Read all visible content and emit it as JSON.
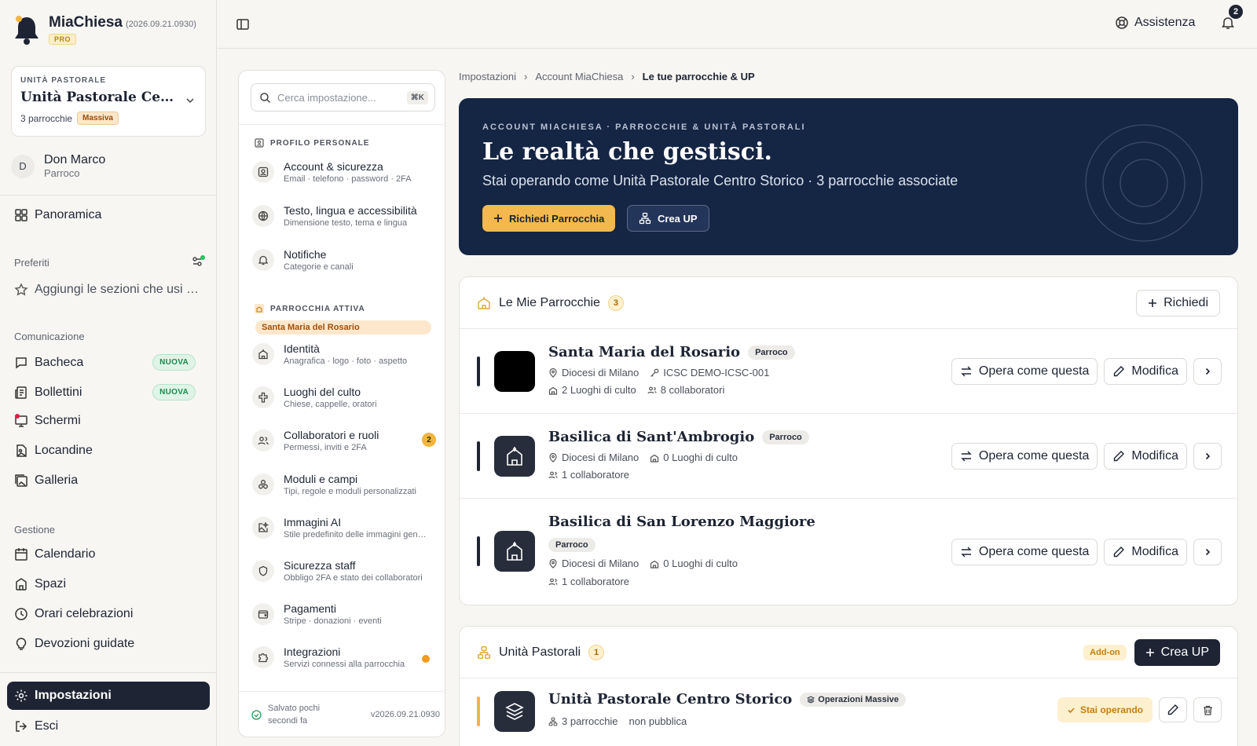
{
  "app": {
    "name": "MiaChiesa",
    "version": "(2026.09.21.0930)",
    "tier": "PRO"
  },
  "unit_card": {
    "eyebrow": "UNITÀ PASTORALE",
    "name": "Unità Pastorale Centro Storico",
    "parishes": "3 parrocchie",
    "badge": "Massiva"
  },
  "user": {
    "initial": "D",
    "name": "Don Marco",
    "role": "Parroco"
  },
  "nav": {
    "overview": "Panoramica",
    "favorites_title": "Preferiti",
    "favorites_hint": "Aggiungi le sezioni che usi …",
    "comm_title": "Comunicazione",
    "comm": [
      {
        "label": "Bacheca",
        "badge": "NUOVA"
      },
      {
        "label": "Bollettini",
        "badge": "NUOVA"
      },
      {
        "label": "Schermi"
      },
      {
        "label": "Locandine"
      },
      {
        "label": "Galleria"
      }
    ],
    "mgmt_title": "Gestione",
    "mgmt": [
      "Calendario",
      "Spazi",
      "Orari celebrazioni",
      "Devozioni guidate"
    ],
    "settings": "Impostazioni",
    "logout": "Esci"
  },
  "topbar": {
    "help": "Assistenza",
    "notif_count": "2"
  },
  "settings_panel": {
    "search_placeholder": "Cerca impostazione...",
    "shortcut": "⌘K",
    "group_personal": "PROFILO PERSONALE",
    "personal": [
      {
        "title": "Account & sicurezza",
        "sub": "Email · telefono · password · 2FA"
      },
      {
        "title": "Testo, lingua e accessibilità",
        "sub": "Dimensione testo, tema e lingua"
      },
      {
        "title": "Notifiche",
        "sub": "Categorie e canali"
      }
    ],
    "group_parish": "PARROCCHIA ATTIVA",
    "active_parish": "Santa Maria del Rosario",
    "parish": [
      {
        "title": "Identità",
        "sub": "Anagrafica · logo · foto · aspetto"
      },
      {
        "title": "Luoghi del culto",
        "sub": "Chiese, cappelle, oratori"
      },
      {
        "title": "Collaboratori e ruoli",
        "sub": "Permessi, inviti e 2FA",
        "badge": "2"
      },
      {
        "title": "Moduli e campi",
        "sub": "Tipi, regole e moduli personalizzati"
      },
      {
        "title": "Immagini AI",
        "sub": "Stile predefinito delle immagini generate"
      },
      {
        "title": "Sicurezza staff",
        "sub": "Obbligo 2FA e stato dei collaboratori"
      },
      {
        "title": "Pagamenti",
        "sub": "Stripe · donazioni · eventi"
      },
      {
        "title": "Integrazioni",
        "sub": "Servizi connessi alla parrocchia"
      }
    ],
    "saved": "Salvato pochi secondi fa",
    "version": "v2026.09.21.0930"
  },
  "breadcrumb": [
    "Impostazioni",
    "Account MiaChiesa",
    "Le tue parrocchie & UP"
  ],
  "hero": {
    "eyebrow": "ACCOUNT MIACHIESA · PARROCCHIE & UNITÀ PASTORALI",
    "title": "Le realtà che gestisci.",
    "subtitle": "Stai operando come Unità Pastorale Centro Storico · 3 parrocchie associate",
    "btn_request": "Richiedi Parrocchia",
    "btn_create": "Crea UP"
  },
  "parishes_card": {
    "title": "Le Mie Parrocchie",
    "count": "3",
    "btn": "Richiedi",
    "rows": [
      {
        "name": "Santa Maria del Rosario",
        "role": "Parroco",
        "diocese": "Diocesi di Milano",
        "code": "ICSC DEMO-ICSC-001",
        "places": "2 Luoghi di culto",
        "collab": "8 collaboratori"
      },
      {
        "name": "Basilica di Sant'Ambrogio",
        "role": "Parroco",
        "diocese": "Diocesi di Milano",
        "places": "0 Luoghi di culto",
        "collab": "1 collaboratore"
      },
      {
        "name": "Basilica di San Lorenzo Maggiore",
        "role": "Parroco",
        "diocese": "Diocesi di Milano",
        "places": "0 Luoghi di culto",
        "collab": "1 collaboratore"
      }
    ],
    "act_operate": "Opera come questa",
    "act_edit": "Modifica"
  },
  "units_card": {
    "title": "Unità Pastorali",
    "count": "1",
    "addon": "Add-on",
    "btn": "Crea UP",
    "row": {
      "name": "Unità Pastorale Centro Storico",
      "badge": "Operazioni Massive",
      "parishes": "3 parrocchie",
      "visibility": "non pubblica",
      "status": "Stai operando"
    }
  }
}
